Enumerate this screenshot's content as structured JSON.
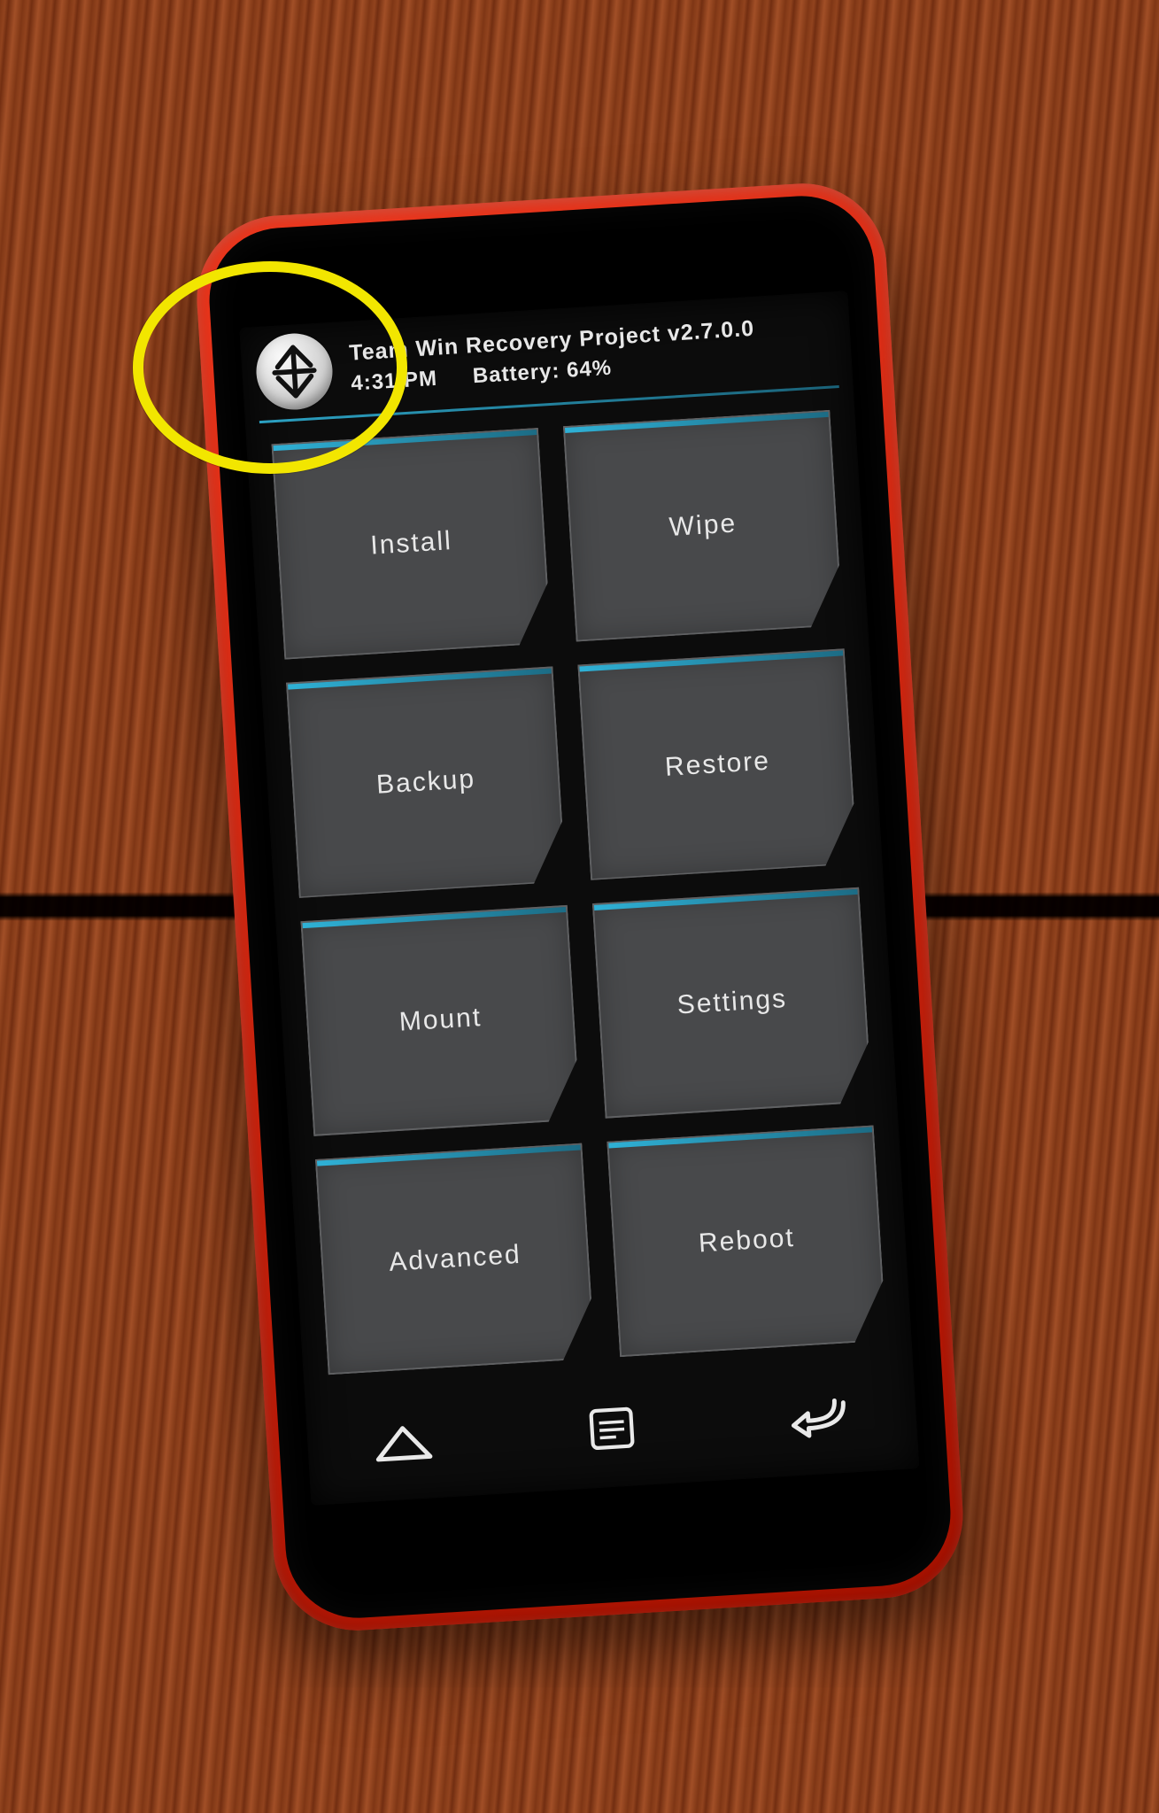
{
  "header": {
    "title": "Team Win Recovery Project  v2.7.0.0",
    "time": "4:31 PM",
    "battery_label": "Battery: 64%"
  },
  "tiles": [
    {
      "id": "install",
      "label": "Install"
    },
    {
      "id": "wipe",
      "label": "Wipe"
    },
    {
      "id": "backup",
      "label": "Backup"
    },
    {
      "id": "restore",
      "label": "Restore"
    },
    {
      "id": "mount",
      "label": "Mount"
    },
    {
      "id": "settings",
      "label": "Settings"
    },
    {
      "id": "advanced",
      "label": "Advanced"
    },
    {
      "id": "reboot",
      "label": "Reboot"
    }
  ],
  "annotation": {
    "target_tile": "install",
    "color": "#f2e600"
  },
  "colors": {
    "accent": "#2fb1d6",
    "phone_case": "#ff3b1f",
    "tile_bg": "#48494b"
  }
}
